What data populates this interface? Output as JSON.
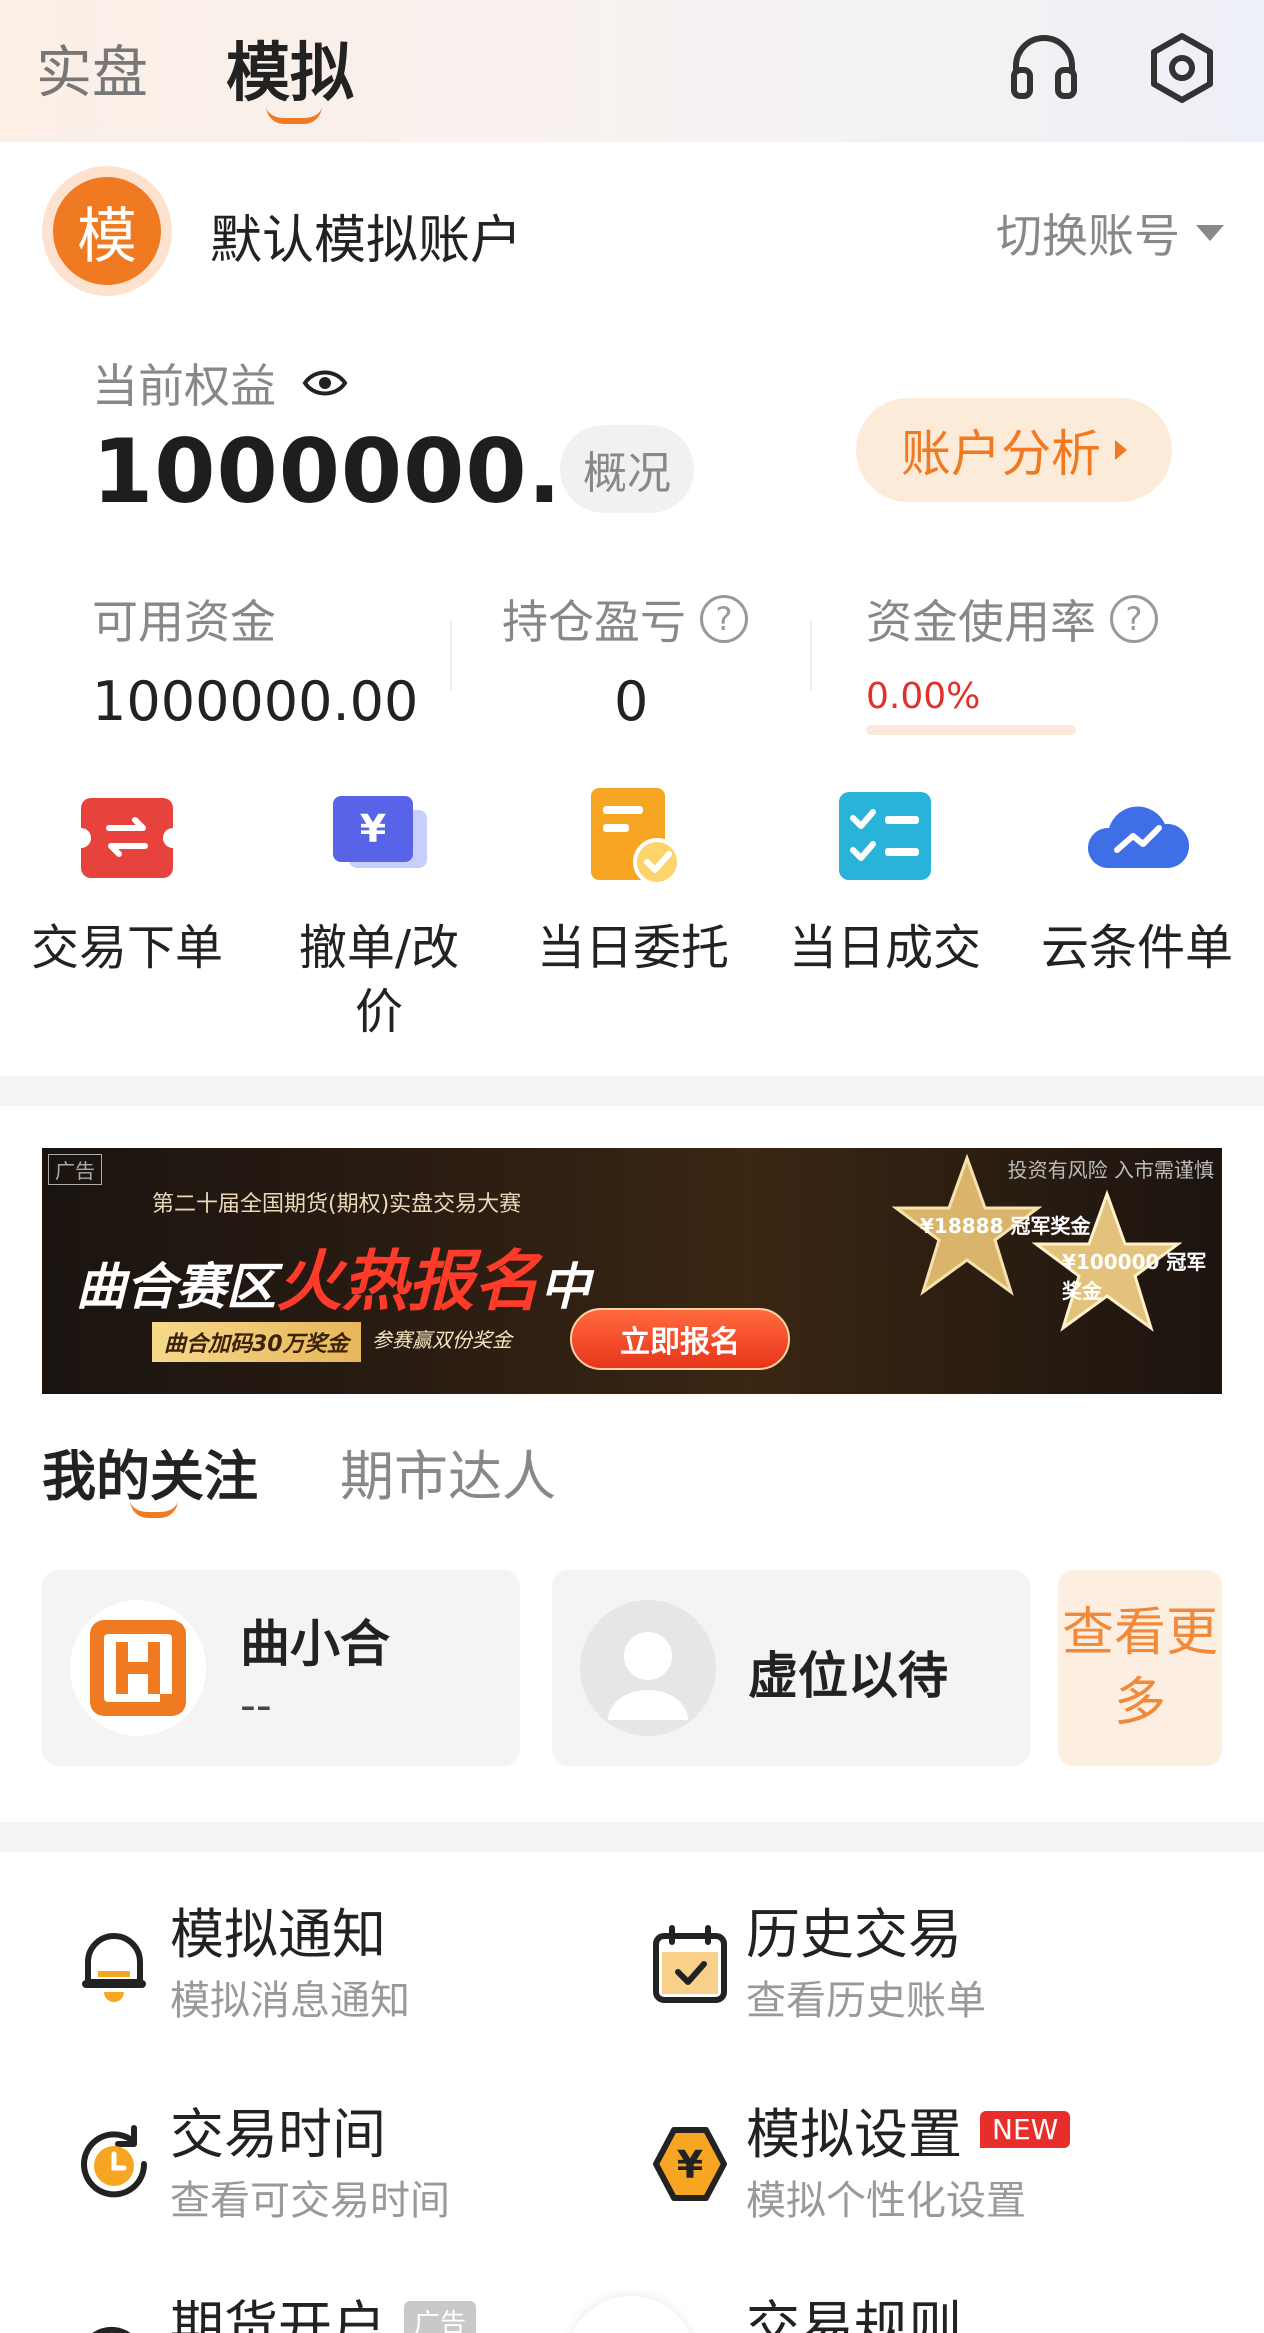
{
  "top_tabs": {
    "real": "实盘",
    "sim": "模拟"
  },
  "account": {
    "avatar_char": "模",
    "name": "默认模拟账户",
    "switch_label": "切换账号"
  },
  "equity": {
    "label": "当前权益",
    "value": "1000000.00",
    "overview": "概况",
    "analysis": "账户分析"
  },
  "stats": [
    {
      "label": "可用资金",
      "value": "1000000.00"
    },
    {
      "label": "持仓盈亏",
      "value": "0"
    },
    {
      "label": "资金使用率",
      "value": "0.00%"
    }
  ],
  "quick_actions": [
    {
      "label": "交易下单",
      "icon": "exchange-icon"
    },
    {
      "label": "撤单/改价",
      "icon": "yen-card-icon"
    },
    {
      "label": "当日委托",
      "icon": "order-check-icon"
    },
    {
      "label": "当日成交",
      "icon": "checklist-icon"
    },
    {
      "label": "云条件单",
      "icon": "cloud-trend-icon"
    }
  ],
  "banner": {
    "ad_tag": "广告",
    "risk": "投资有风险 入市需谨慎",
    "subtitle": "第二十届全国期货(期权)实盘交易大赛",
    "title_a": "曲合赛区",
    "title_b": "火热报名",
    "title_c": "中",
    "bonus": "曲合加码30万奖金",
    "bonus2": "参赛赢双份奖金",
    "button": "立即报名",
    "prize1": "¥18888 冠军奖金",
    "prize2": "¥100000 冠军奖金"
  },
  "follow": {
    "tabs": [
      "我的关注",
      "期市达人"
    ],
    "cards": [
      {
        "name": "曲小合",
        "sub": "--"
      },
      {
        "name": "虚位以待"
      }
    ],
    "more": "查看更多"
  },
  "menu": [
    {
      "title": "模拟通知",
      "sub": "模拟消息通知",
      "icon": "bell-icon"
    },
    {
      "title": "历史交易",
      "sub": "查看历史账单",
      "icon": "calendar-check-icon"
    },
    {
      "title": "交易时间",
      "sub": "查看可交易时间",
      "icon": "clock-icon"
    },
    {
      "title": "模拟设置",
      "sub": "模拟个性化设置",
      "icon": "hex-yen-icon",
      "badge": "NEW"
    },
    {
      "title": "期货开户",
      "icon": "account-open-icon",
      "badge": "广告"
    },
    {
      "title": "交易规则",
      "icon": "rules-icon"
    }
  ],
  "colors": {
    "accent": "#f07a22",
    "loss_red": "#e0312a",
    "badge_red": "#e82e2b"
  }
}
